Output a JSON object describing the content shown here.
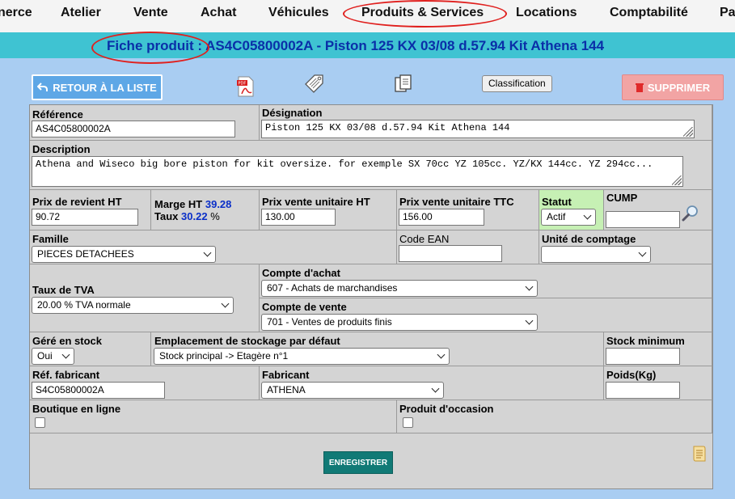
{
  "nav": {
    "items": [
      "nerce",
      "Atelier",
      "Vente",
      "Achat",
      "Véhicules",
      "Produits & Services",
      "Locations",
      "Comptabilité",
      "Pa"
    ]
  },
  "header": {
    "title": "Fiche produit : AS4C05800002A - Piston 125 KX 03/08 d.57.94 Kit Athena 144"
  },
  "toolbar": {
    "back_label": "RETOUR À LA LISTE",
    "classification_label": "Classification",
    "delete_label": "SUPPRIMER"
  },
  "form": {
    "reference": {
      "label": "Référence",
      "value": "AS4C05800002A"
    },
    "designation": {
      "label": "Désignation",
      "value": "Piston 125 KX 03/08 d.57.94 Kit Athena 144"
    },
    "description": {
      "label": "Description",
      "value": "Athena and Wiseco big bore piston for kit oversize. for exemple SX 70cc YZ 105cc. YZ/KX 144cc. YZ 294cc..."
    },
    "prix_revient": {
      "label": "Prix de revient HT",
      "value": "90.72"
    },
    "marge": {
      "label": "Marge HT",
      "value": "39.28",
      "taux_label": "Taux",
      "taux_value": "30.22",
      "taux_unit": "%"
    },
    "prix_vente_ht": {
      "label": "Prix vente unitaire HT",
      "value": "130.00"
    },
    "prix_vente_ttc": {
      "label": "Prix vente unitaire TTC",
      "value": "156.00"
    },
    "statut": {
      "label": "Statut",
      "value": "Actif"
    },
    "cump": {
      "label": "CUMP",
      "value": ""
    },
    "famille": {
      "label": "Famille",
      "value": "PIECES DETACHEES"
    },
    "code_ean": {
      "label": "Code EAN",
      "value": ""
    },
    "unite": {
      "label": "Unité de comptage",
      "value": ""
    },
    "tva": {
      "label": "Taux de TVA",
      "value": "20.00 % TVA normale"
    },
    "compte_achat": {
      "label": "Compte d'achat",
      "value": "607 - Achats de marchandises"
    },
    "compte_vente": {
      "label": "Compte de vente",
      "value": "701 - Ventes de produits finis"
    },
    "gere_stock": {
      "label": "Géré en stock",
      "value": "Oui"
    },
    "emplacement": {
      "label": "Emplacement de stockage par défaut",
      "value": "Stock principal -> Etagère n°1"
    },
    "stock_min": {
      "label": "Stock minimum",
      "value": ""
    },
    "ref_fabricant": {
      "label": "Réf. fabricant",
      "value": "S4C05800002A"
    },
    "fabricant": {
      "label": "Fabricant",
      "value": "ATHENA"
    },
    "poids": {
      "label": "Poids(Kg)",
      "value": ""
    },
    "boutique": {
      "label": "Boutique en ligne"
    },
    "occasion": {
      "label": "Produit d'occasion"
    },
    "save_label": "ENREGISTRER"
  },
  "colors": {
    "header_bar": "#3fc3d2",
    "title_text": "#0a2fa8",
    "annotation": "#e0201e",
    "save_button": "#117a76",
    "statut_bg": "#c6f0b4"
  }
}
